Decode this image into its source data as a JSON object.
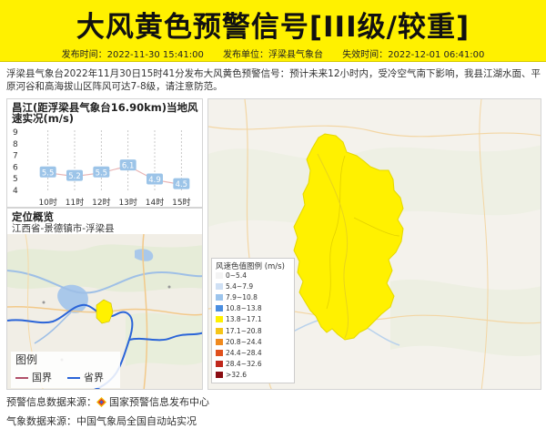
{
  "banner": {
    "title": "大风黄色预警信号[III级/较重]",
    "color": "#fff100",
    "publish_time_label": "发布时间：",
    "publish_time": "2022-11-30 15:41:00",
    "publisher_label": "发布单位：",
    "publisher": "浮梁县气象台",
    "expire_label": "失效时间：",
    "expire_time": "2022-12-01 06:41:00"
  },
  "description": "浮梁县气象台2022年11月30日15时41分发布大风黄色预警信号：预计未来12小时内，受冷空气南下影响，我县江湖水面、平原河谷和高海拔山区阵风可达7-8级，请注意防范。",
  "wind_panel": {
    "title": "昌江(距浮梁县气象台16.90km)当地风速实况(m/s)"
  },
  "chart_data": {
    "type": "line",
    "title": "昌江(距浮梁县气象台16.90km)当地风速实况(m/s)",
    "categories": [
      "10时",
      "11时",
      "12时",
      "13时",
      "14时",
      "15时"
    ],
    "values": [
      5.5,
      5.2,
      5.5,
      6.1,
      4.9,
      4.5
    ],
    "ylim": [
      4,
      9
    ],
    "yticks": [
      4,
      5,
      6,
      7,
      8,
      9
    ],
    "line_color": "#e8b4b4",
    "label_bg": "#9cc4e8"
  },
  "location_panel": {
    "title": "定位概览",
    "subtitle": "江西省-景德镇市-浮梁县",
    "legend_title": "图例",
    "legend_items": [
      {
        "label": "国界",
        "color": "#b0506a"
      },
      {
        "label": "省界",
        "color": "#2a64d8"
      }
    ]
  },
  "wind_legend": {
    "title": "风速色值图例 (m/s)",
    "items": [
      {
        "label": "0~5.4",
        "color": "#f4f4f4"
      },
      {
        "label": "5.4~7.9",
        "color": "#cfe0f4"
      },
      {
        "label": "7.9~10.8",
        "color": "#9cc4ec"
      },
      {
        "label": "10.8~13.8",
        "color": "#4a8ee0"
      },
      {
        "label": "13.8~17.1",
        "color": "#fff100"
      },
      {
        "label": "17.1~20.8",
        "color": "#f5c518"
      },
      {
        "label": "20.8~24.4",
        "color": "#f08a1e"
      },
      {
        "label": "24.4~28.4",
        "color": "#e0501c"
      },
      {
        "label": "28.4~32.6",
        "color": "#c0281c"
      },
      {
        "label": ">32.6",
        "color": "#8a0d12"
      }
    ]
  },
  "footer": {
    "warning_source_label": "预警信息数据来源：",
    "warning_source": "国家预警信息发布中心",
    "weather_source_label": "气象数据来源：",
    "weather_source": "中国气象局全国自动站实况"
  }
}
